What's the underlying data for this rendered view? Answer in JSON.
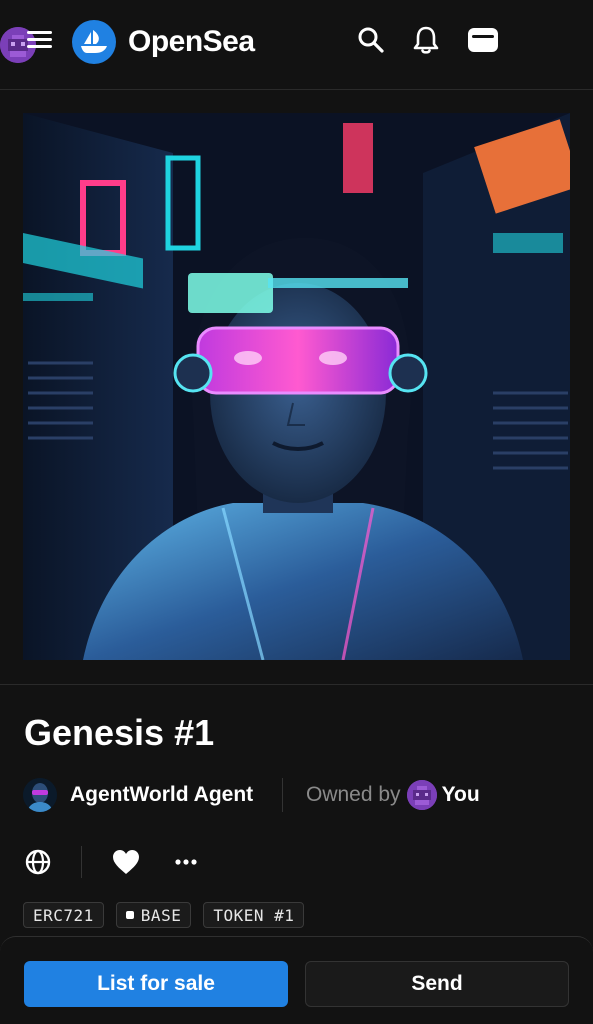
{
  "header": {
    "logo_text": "OpenSea",
    "icons": [
      "menu-icon",
      "opensea-logo-icon",
      "search-icon",
      "bell-icon",
      "wallet-icon",
      "profile-avatar"
    ]
  },
  "nft": {
    "image_alt": "Cyberpunk portrait artwork",
    "title": "Genesis #1",
    "creator": {
      "name": "AgentWorld Agent"
    },
    "owner": {
      "label": "Owned by",
      "name": "You"
    },
    "badges": [
      "ERC721",
      "BASE",
      "TOKEN #1"
    ]
  },
  "actions": {
    "icons": [
      "globe-icon",
      "heart-icon",
      "more-icon"
    ]
  },
  "footer": {
    "list_label": "List for sale",
    "send_label": "Send"
  },
  "colors": {
    "background": "#121212",
    "accent": "#2081e2",
    "muted_text": "#8a8a8a"
  }
}
